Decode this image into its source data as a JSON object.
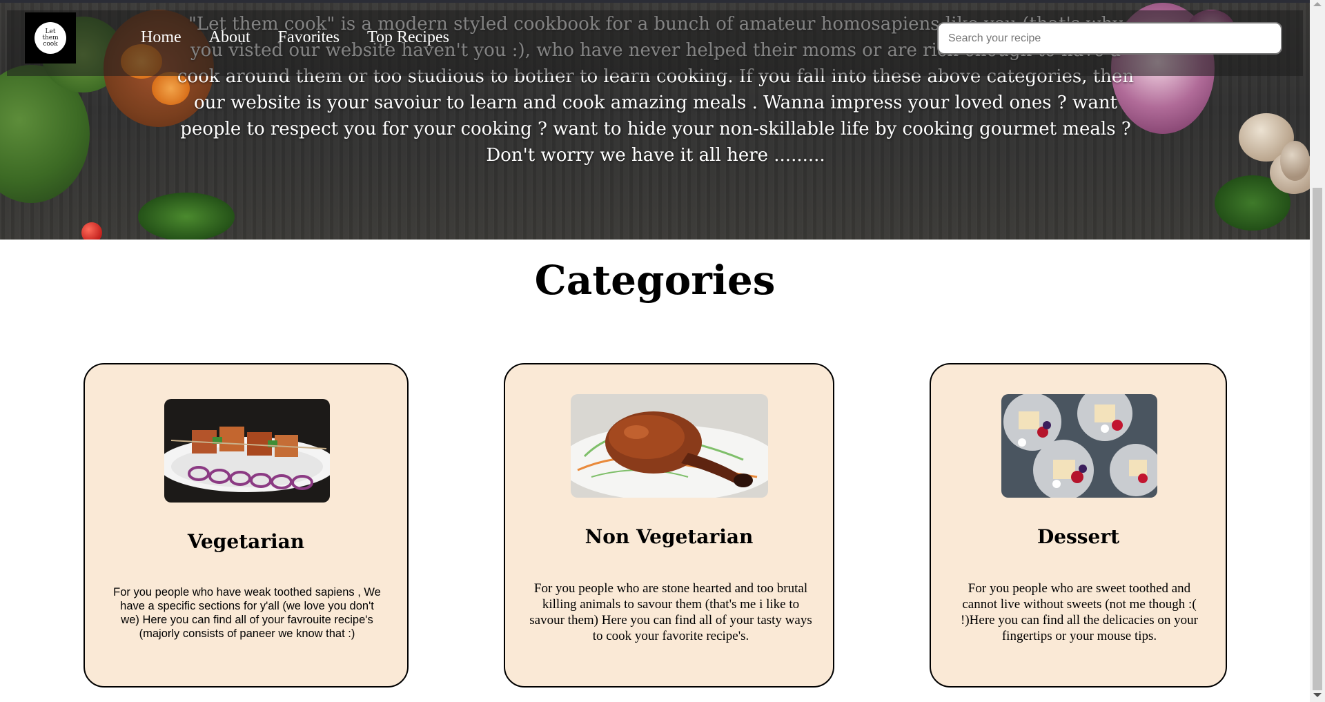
{
  "hero": {
    "description": "\"Let them cook\" is a modern styled cookbook for a bunch of amateur homosapiens like you (that's why you visted our website haven't you :), who have never helped their moms or are rich enough to have a cook around them or too studious to bother to learn cooking. If you fall into these above categories, then our website is your savoiur to learn and cook amazing meals . Wanna impress your loved ones ? want people to respect you for your cooking ? want to hide your non-skillable life by cooking gourmet meals ? Don't worry we have it all here ........."
  },
  "nav": {
    "logo_text": "Let them cook",
    "links": [
      "Home",
      "About",
      "Favorites",
      "Top Recipes"
    ],
    "search_placeholder": "Search your recipe"
  },
  "categories": {
    "title": "Categories",
    "cards": [
      {
        "name": "Vegetarian",
        "text": "For you people who have weak toothed sapiens , We have a specific sections for y'all (we love you don't we) Here you can find all of your favrouite recipe's (majorly consists of paneer we know that :)"
      },
      {
        "name": "Non Vegetarian",
        "text": "For you people who are stone hearted and too brutal killing animals to savour them (that's me i like to savour them) Here you can find all of your tasty ways to cook your favorite recipe's."
      },
      {
        "name": "Dessert",
        "text": "For you people who are sweet toothed and cannot live without sweets (not me though :( !)Here you can find all the delicacies on your fingertips or your mouse tips."
      }
    ]
  }
}
